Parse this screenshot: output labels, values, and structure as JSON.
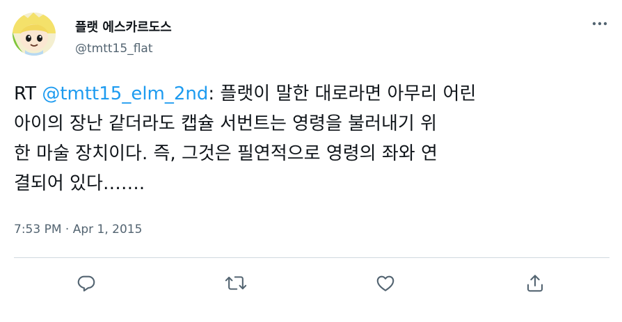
{
  "author": {
    "display_name": "플랫 에스카르도스",
    "handle": "@tmtt15_flat"
  },
  "tweet": {
    "prefix": "RT ",
    "mention": "@tmtt15_elm_2nd",
    "body": ": 플랫이 말한 대로라면 아무리 어린\n아이의 장난 같더라도 캡슐 서번트는 영령을 불러내기 위\n한 마술 장치이다. 즉, 그것은 필연적으로 영령의 좌와 연\n결되어 있다……."
  },
  "meta": {
    "time": "7:53 PM",
    "separator": " · ",
    "date": "Apr 1, 2015"
  },
  "actions": {
    "icons": [
      "reply-icon",
      "retweet-icon",
      "like-icon",
      "share-icon"
    ]
  },
  "colors": {
    "accent": "#1d9bf0",
    "text": "#0f1419",
    "secondary": "#536471",
    "divider": "#cfd9de"
  }
}
